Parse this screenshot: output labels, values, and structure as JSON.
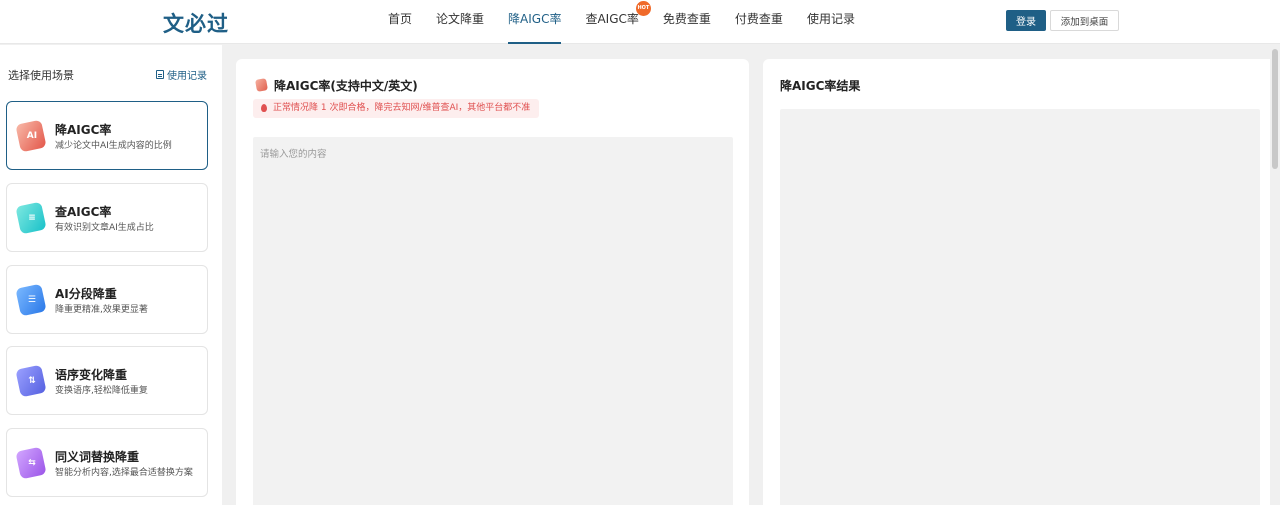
{
  "header": {
    "logo": "文必过",
    "nav": [
      {
        "label": "首页",
        "active": false
      },
      {
        "label": "论文降重",
        "active": false
      },
      {
        "label": "降AIGC率",
        "active": true
      },
      {
        "label": "查AIGC率",
        "active": false,
        "badge": "HOT"
      },
      {
        "label": "免费查重",
        "active": false
      },
      {
        "label": "付费查重",
        "active": false
      },
      {
        "label": "使用记录",
        "active": false
      }
    ],
    "login_label": "登录",
    "add_desktop_label": "添加到桌面"
  },
  "sidebar": {
    "title": "选择使用场景",
    "history_link": "使用记录",
    "items": [
      {
        "name": "降AIGC率",
        "desc": "减少论文中AI生成内容的比例",
        "icon": "ai-reduce-icon",
        "glyph": "AI",
        "color_from": "#f8b9a8",
        "color_to": "#e3574a",
        "active": true
      },
      {
        "name": "查AIGC率",
        "desc": "有效识别文章AI生成占比",
        "icon": "ai-check-icon",
        "glyph": "≡",
        "color_from": "#7ee8e0",
        "color_to": "#19c1c9",
        "active": false
      },
      {
        "name": "AI分段降重",
        "desc": "降重更精准,效果更显著",
        "icon": "segment-icon",
        "glyph": "☰",
        "color_from": "#7ab8ff",
        "color_to": "#2a78e8",
        "active": false
      },
      {
        "name": "语序变化降重",
        "desc": "变换语序,轻松降低重复",
        "icon": "word-order-icon",
        "glyph": "⇅",
        "color_from": "#9aa0ff",
        "color_to": "#5560e0",
        "active": false
      },
      {
        "name": "同义词替换降重",
        "desc": "智能分析内容,选择最合适替换方案",
        "icon": "synonym-icon",
        "glyph": "⇆",
        "color_from": "#d2a6ff",
        "color_to": "#9b55e8",
        "active": false
      }
    ]
  },
  "input_panel": {
    "title": "降AIGC率(支持中文/英文)",
    "tip": "正常情况降 1 次即合格，降完去知网/维普查AI，其他平台都不准",
    "placeholder": "请输入您的内容"
  },
  "result_panel": {
    "title": "降AIGC率结果"
  },
  "colors": {
    "primary": "#1f5f86",
    "hot_badge": "#f06a2a",
    "tip_text": "#e05050",
    "tip_bg": "#fdeeee"
  }
}
